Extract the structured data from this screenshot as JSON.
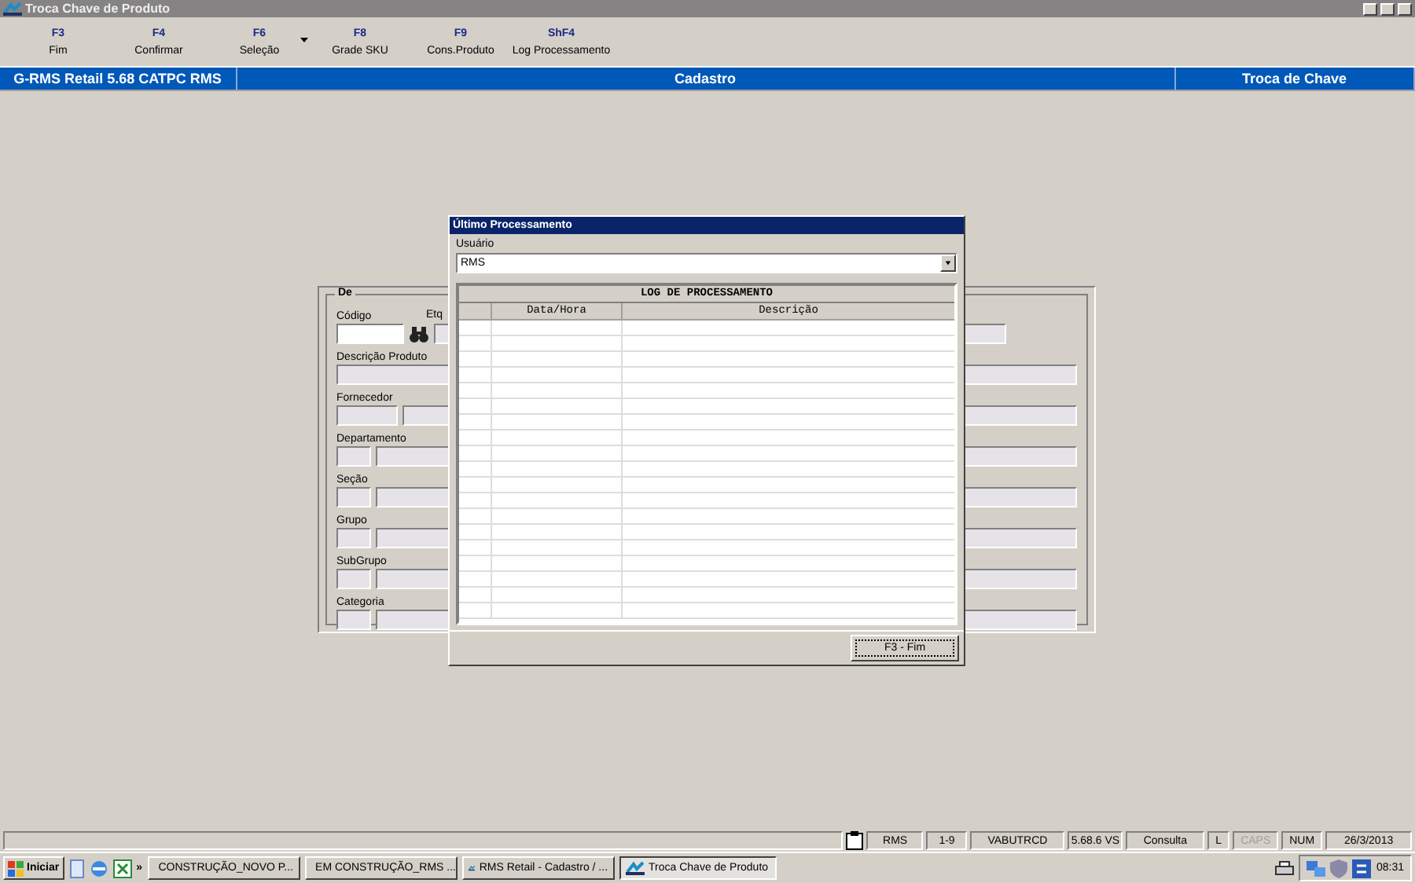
{
  "window": {
    "title": "Troca Chave de Produto"
  },
  "toolbar": [
    {
      "key": "F3",
      "label": "Fim",
      "dropdown": false
    },
    {
      "key": "F4",
      "label": "Confirmar",
      "dropdown": false
    },
    {
      "key": "F6",
      "label": "Seleção",
      "dropdown": true
    },
    {
      "key": "F8",
      "label": "Grade SKU",
      "dropdown": false
    },
    {
      "key": "F9",
      "label": "Cons.Produto",
      "dropdown": false
    },
    {
      "key": "ShF4",
      "label": "Log Processamento",
      "dropdown": false
    }
  ],
  "header": [
    "G-RMS Retail 5.68 CATPC RMS",
    "Cadastro",
    "Troca de Chave"
  ],
  "form": {
    "legend": "De",
    "rows": [
      {
        "label": "Código",
        "kind": "code",
        "side_label": "Etq"
      },
      {
        "label": "Descrição Produto",
        "kind": "single"
      },
      {
        "label": "Fornecedor",
        "kind": "pair_wide"
      },
      {
        "label": "Departamento",
        "kind": "pair"
      },
      {
        "label": "Seção",
        "kind": "pair"
      },
      {
        "label": "Grupo",
        "kind": "pair"
      },
      {
        "label": "SubGrupo",
        "kind": "pair"
      },
      {
        "label": "Categoria",
        "kind": "pair"
      }
    ]
  },
  "dialog": {
    "title": "Último Processamento",
    "user_label": "Usuário",
    "user_value": "RMS",
    "table_title": "LOG DE PROCESSAMENTO",
    "columns": [
      "Data/Hora",
      "Descrição"
    ],
    "button": "F3 - Fim"
  },
  "status_bar": {
    "cells": [
      "RMS",
      "1-9",
      "VABUTRCD",
      "5.68.6 VS",
      "Consulta"
    ],
    "indicators": [
      {
        "label": "L",
        "on": true
      },
      {
        "label": "CAPS",
        "on": false
      },
      {
        "label": "NUM",
        "on": true
      }
    ],
    "date": "26/3/2013"
  },
  "taskbar": {
    "start": "Iniciar",
    "more": "»",
    "tasks": [
      {
        "label": "CONSTRUÇÃO_NOVO P...",
        "kind": "folder",
        "selected": false
      },
      {
        "label": "EM CONSTRUÇÃO_RMS ...",
        "kind": "document",
        "selected": false
      },
      {
        "label": "RMS Retail - Cadastro / ...",
        "kind": "app",
        "selected": false
      },
      {
        "label": "Troca Chave de Produto",
        "kind": "app",
        "selected": true
      }
    ],
    "clock": "08:31"
  }
}
